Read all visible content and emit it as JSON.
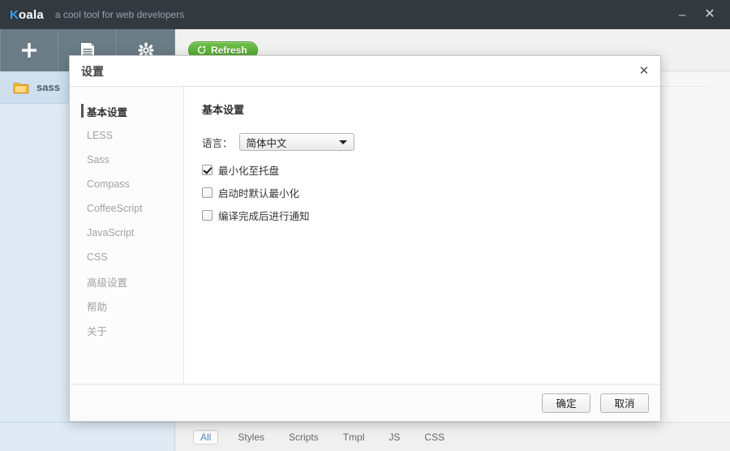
{
  "titlebar": {
    "brand_first": "K",
    "brand_rest": "oala",
    "tagline": "a cool tool for web developers",
    "minimize_icon": "minimize-icon",
    "minimize_glyph": "–",
    "close_icon": "close-icon",
    "close_glyph": "✕",
    "background": "#323a40",
    "accent": "#3d9ae8"
  },
  "toolbar": {
    "add_icon": "plus-icon",
    "files_icon": "document-list-icon",
    "settings_icon": "gear-icon",
    "refresh_label": "Refresh",
    "refresh_icon": "refresh-circular-arrow-icon",
    "refresh_color": "#5faf36"
  },
  "projects": {
    "items": [
      {
        "name": "sass",
        "icon": "folder-icon"
      }
    ]
  },
  "statusbar": {
    "filters": [
      {
        "label": "All",
        "active": true
      },
      {
        "label": "Styles",
        "active": false
      },
      {
        "label": "Scripts",
        "active": false
      },
      {
        "label": "Tmpl",
        "active": false
      },
      {
        "label": "JS",
        "active": false
      },
      {
        "label": "CSS",
        "active": false
      }
    ],
    "active_color": "#4f86c6"
  },
  "dialog": {
    "title": "设置",
    "close_glyph": "✕",
    "nav": [
      {
        "label": "基本设置",
        "active": true
      },
      {
        "label": "LESS",
        "active": false
      },
      {
        "label": "Sass",
        "active": false
      },
      {
        "label": "Compass",
        "active": false
      },
      {
        "label": "CoffeeScript",
        "active": false
      },
      {
        "label": "JavaScript",
        "active": false
      },
      {
        "label": "CSS",
        "active": false
      },
      {
        "label": "高级设置",
        "active": false
      },
      {
        "label": "帮助",
        "active": false
      },
      {
        "label": "关于",
        "active": false
      }
    ],
    "content": {
      "heading": "基本设置",
      "language_label": "语言：",
      "language_value": "简体中文",
      "language_options": [
        "简体中文"
      ],
      "checkboxes": [
        {
          "label": "最小化至托盘",
          "checked": true
        },
        {
          "label": "启动时默认最小化",
          "checked": false
        },
        {
          "label": "编译完成后进行通知",
          "checked": false
        }
      ]
    },
    "footer": {
      "ok_label": "确定",
      "cancel_label": "取消"
    }
  }
}
